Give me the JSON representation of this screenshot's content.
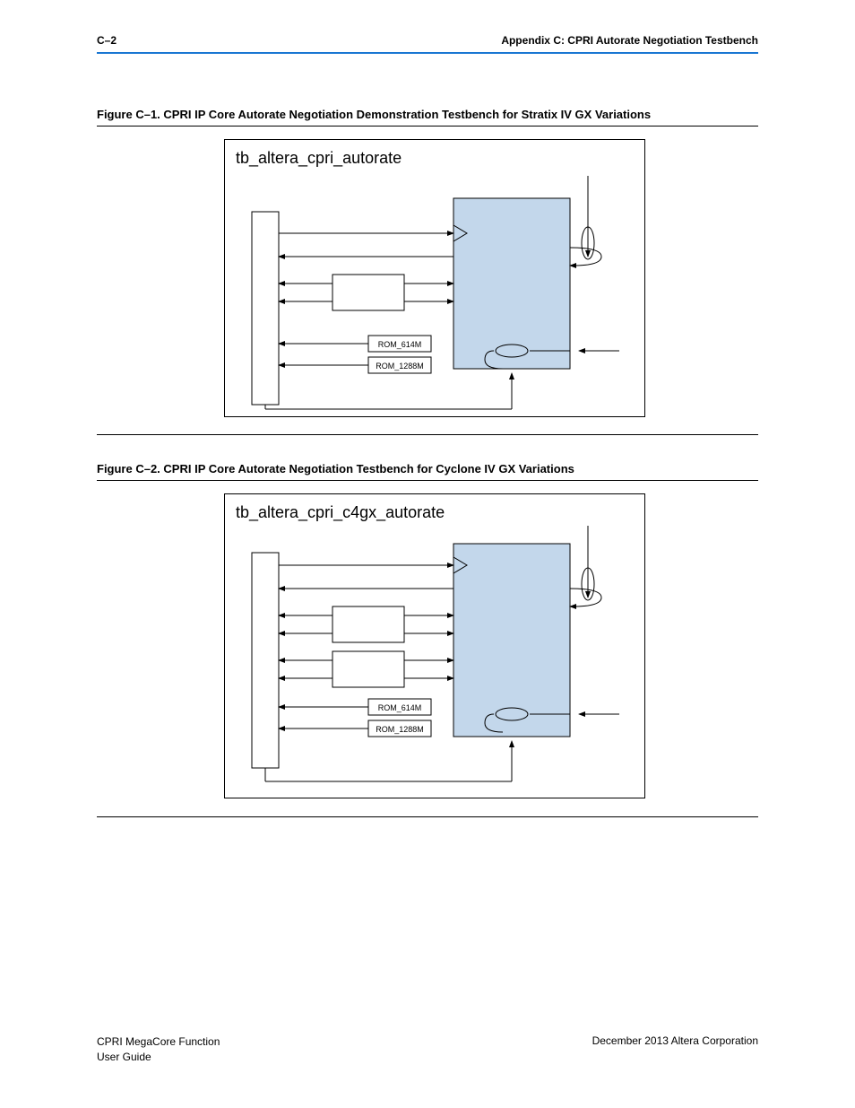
{
  "header": {
    "left": "C–2",
    "right": "Appendix C: CPRI Autorate Negotiation Testbench"
  },
  "figure1": {
    "title": "Figure C–1.  CPRI IP Core Autorate Negotiation Demonstration Testbench for Stratix IV GX Variations",
    "diagram_title": "tb_altera_cpri_autorate",
    "rom1": "ROM_614M",
    "rom2": "ROM_1288M"
  },
  "figure2": {
    "title": "Figure C–2.  CPRI IP Core Autorate Negotiation Testbench for Cyclone IV GX Variations",
    "diagram_title": "tb_altera_cpri_c4gx_autorate",
    "rom1": "ROM_614M",
    "rom2": "ROM_1288M"
  },
  "footer": {
    "left_line1": "CPRI MegaCore Function",
    "left_line2": "User Guide",
    "right": "December 2013   Altera Corporation"
  }
}
